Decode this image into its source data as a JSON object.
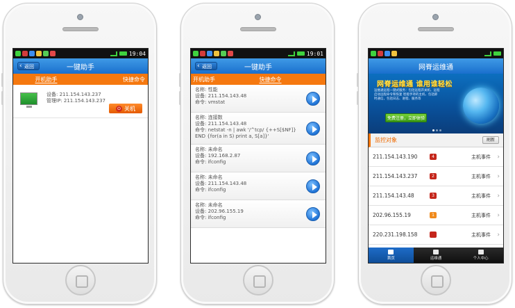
{
  "screen1": {
    "status_time": "19:04",
    "back_label": "返回",
    "title": "一键助手",
    "tabs": [
      {
        "label": "开机助手"
      },
      {
        "label": "快捷命令"
      }
    ],
    "device": {
      "device_label": "设备:",
      "device_value": "211.154.143.237",
      "admin_label": "管理IP:",
      "admin_value": "211.154.143.237"
    },
    "power_button": "关机"
  },
  "screen2": {
    "status_time": "19:01",
    "back_label": "返回",
    "title": "一键助手",
    "tabs": [
      {
        "label": "开机助手"
      },
      {
        "label": "快捷命令"
      }
    ],
    "name_label": "名称:",
    "device_label": "设备:",
    "cmd_label": "命令:",
    "items": [
      {
        "name": "性能",
        "device": "211.154.143.48",
        "cmd": "vmstat"
      },
      {
        "name": "连接数",
        "device": "211.154.143.48",
        "cmd": "netstat -n | awk '/^tcp/ {++S[$NF]} END {for(a in S) print a, S[a]}'"
      },
      {
        "name": "未命名",
        "device": "192.168.2.87",
        "cmd": "ifconfig"
      },
      {
        "name": "未命名",
        "device": "211.154.143.48",
        "cmd": "ifconfig"
      },
      {
        "name": "未命名",
        "device": "202.96.155.19",
        "cmd": "ifconfig"
      }
    ]
  },
  "screen3": {
    "title": "网脊运维通",
    "banner": {
      "headline": "网脊运维通 谁用谁轻松",
      "desc": "运维通远程一键式服务：包括远程开关机、远程启动远程命令和恢复 智能手持的主机、包括即时通信，包括日志、进程、服务等",
      "register_button": "免费注册，立即体验"
    },
    "section_label": "监控对象",
    "refresh_label": "刷新",
    "event_label": "主机事件",
    "hosts": [
      {
        "ip": "211.154.143.190",
        "count": "4",
        "color": "#c4261b"
      },
      {
        "ip": "211.154.143.237",
        "count": "2",
        "color": "#c4261b"
      },
      {
        "ip": "211.154.143.48",
        "count": "3",
        "color": "#c4261b"
      },
      {
        "ip": "202.96.155.19",
        "count": "1",
        "color": "#f08a1c"
      },
      {
        "ip": "220.231.198.158",
        "count": "",
        "color": "#c4261b"
      }
    ],
    "nav": [
      {
        "label": "首页"
      },
      {
        "label": "运维通"
      },
      {
        "label": "个人中心"
      }
    ]
  }
}
